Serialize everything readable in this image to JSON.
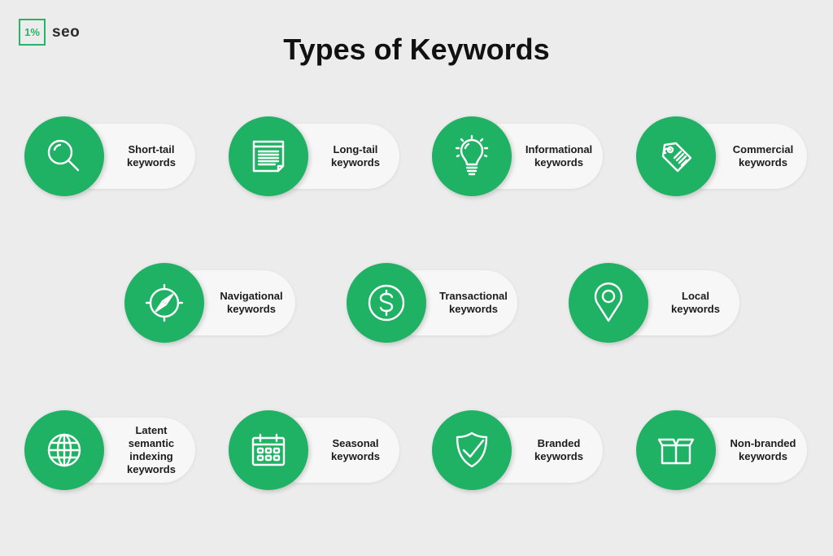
{
  "logo": {
    "badge": "1%",
    "text": "seo"
  },
  "title": "Types of Keywords",
  "colors": {
    "accent": "#1fb264",
    "background": "#ececec",
    "pill": "#f7f7f7"
  },
  "cards": [
    {
      "label": "Short-tail\nkeywords",
      "icon": "search-icon"
    },
    {
      "label": "Long-tail\nkeywords",
      "icon": "document-icon"
    },
    {
      "label": "Informational\nkeywords",
      "icon": "lightbulb-icon"
    },
    {
      "label": "Commercial\nkeywords",
      "icon": "price-tag-icon"
    },
    {
      "label": "Navigational\nkeywords",
      "icon": "compass-icon"
    },
    {
      "label": "Transactional\nkeywords",
      "icon": "dollar-icon"
    },
    {
      "label": "Local\nkeywords",
      "icon": "location-pin-icon"
    },
    {
      "label": "Latent\nsemantic\nindexing\nkeywords",
      "icon": "globe-icon"
    },
    {
      "label": "Seasonal\nkeywords",
      "icon": "calendar-icon"
    },
    {
      "label": "Branded\nkeywords",
      "icon": "shield-check-icon"
    },
    {
      "label": "Non-branded\nkeywords",
      "icon": "box-icon"
    }
  ]
}
